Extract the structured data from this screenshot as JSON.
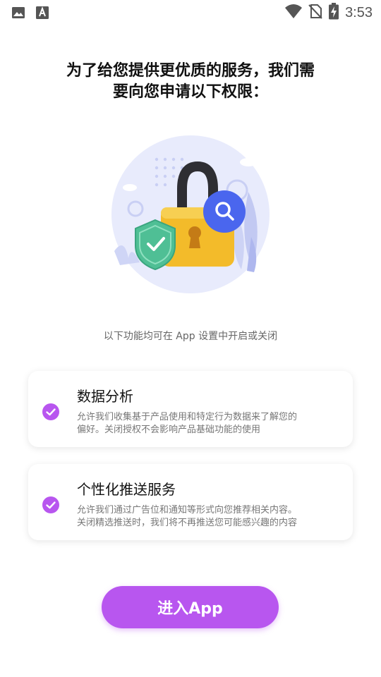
{
  "status_bar": {
    "time": "3:53",
    "left_icons": [
      "image-icon",
      "font-a-icon"
    ],
    "right_icons": [
      "wifi-icon",
      "no-sim-icon",
      "battery-charging-icon"
    ]
  },
  "header": {
    "title_line1": "为了给您提供更优质的服务，我们需",
    "title_line2": "要向您申请以下权限："
  },
  "illustration": {
    "icon": "padlock-shield-search-illustration"
  },
  "hint": "以下功能均可在 App 设置中开启或关闭",
  "permissions": [
    {
      "title": "数据分析",
      "desc_line1": "允许我们收集基于产品使用和特定行为数据来了解您的",
      "desc_line2": "偏好。关闭授权不会影响产品基础功能的使用",
      "checked": true
    },
    {
      "title": "个性化推送服务",
      "desc_line1": "允许我们通过广告位和通知等形式向您推荐相关内容。",
      "desc_line2": "关闭精选推送时，我们将不再推送您可能感兴趣的内容",
      "checked": true
    }
  ],
  "enter_button": {
    "label": "进入App"
  },
  "colors": {
    "accent": "#b856ef",
    "lock": "#f2b92c",
    "shield": "#4fbf95",
    "search": "#4a66ee"
  }
}
